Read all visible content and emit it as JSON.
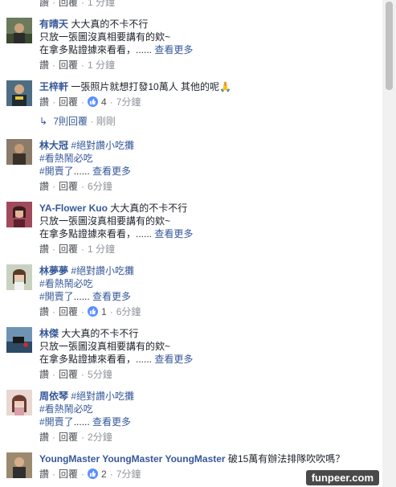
{
  "top_meta": {
    "like": "讚",
    "reply": "回覆",
    "time": "1 分鐘"
  },
  "comments": [
    {
      "author": "有晴天",
      "line1": "大大真的不卡不行",
      "line2": "只放一張圖沒真相要講有的欸~",
      "line3": "在拿多點證據來看看，......",
      "more": "查看更多",
      "like": "讚",
      "reply": "回覆",
      "time": "1 分鐘"
    },
    {
      "author": "王梓軒",
      "line1": "一張照片就想打發10萬人 其他的呢🙏",
      "like": "讚",
      "reply": "回覆",
      "likes": "4",
      "time": "7分鐘"
    },
    {
      "author": "林大冠",
      "hashtag1": "#絕對讚小吃攤",
      "hashtag2": "#看熱鬧必吃",
      "hashtag3": "#開賣了",
      "ellipsis": "......",
      "more": "查看更多",
      "like": "讚",
      "reply": "回覆",
      "time": "6分鐘"
    },
    {
      "author": "YA-Flower Kuo",
      "line1": "大大真的不卡不行",
      "line2": "只放一張圖沒真相要講有的欸~",
      "line3": "在拿多點證據來看看，......",
      "more": "查看更多",
      "like": "讚",
      "reply": "回覆",
      "time": "1 分鐘"
    },
    {
      "author": "林夢夢",
      "hashtag1": "#絕對讚小吃攤",
      "hashtag2": "#看熱鬧必吃",
      "hashtag3": "#開賣了",
      "ellipsis": "......",
      "more": "查看更多",
      "like": "讚",
      "reply": "回覆",
      "likes": "1",
      "time": "6分鐘"
    },
    {
      "author": "林傑",
      "line1": "大大真的不卡不行",
      "line2": "只放一張圖沒真相要講有的欸~",
      "line3": "在拿多點證據來看看，......",
      "more": "查看更多",
      "like": "讚",
      "reply": "回覆",
      "time": "5分鐘"
    },
    {
      "author": "周依琴",
      "hashtag1": "#絕對讚小吃攤",
      "hashtag2": "#看熱鬧必吃",
      "hashtag3": "#開賣了",
      "ellipsis": "......",
      "more": "查看更多",
      "like": "讚",
      "reply": "回覆",
      "time": "2分鐘"
    },
    {
      "author": "YoungMaster YoungMaster YoungMaster",
      "line1": "破15萬有辦法排隊吹吹嗎？",
      "like": "讚",
      "reply": "回覆",
      "likes": "2",
      "time": "7分鐘"
    }
  ],
  "replies_link": {
    "count_label": "7則回覆",
    "time": "剛剛"
  },
  "watermark": "funpeer.com",
  "colors": {
    "link": "#365899",
    "meta": "#90949c",
    "like_badge": "#5890ff"
  }
}
